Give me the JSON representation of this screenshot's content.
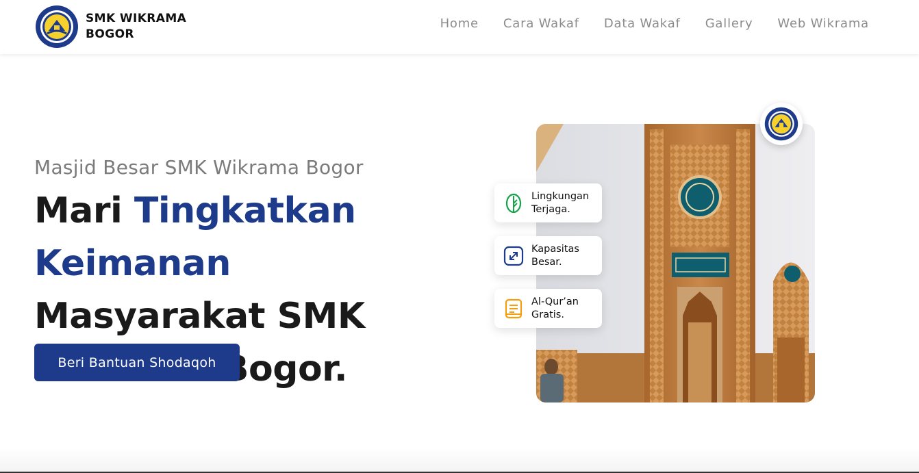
{
  "header": {
    "brand_line1": "SMK WIKRAMA",
    "brand_line2": "BOGOR",
    "logo_icon": "school-logo-icon",
    "nav": [
      {
        "label": "Home"
      },
      {
        "label": "Cara Wakaf"
      },
      {
        "label": "Data Wakaf"
      },
      {
        "label": "Gallery"
      },
      {
        "label": "Web Wikrama"
      }
    ]
  },
  "hero": {
    "subtitle": "Masjid Besar SMK Wikrama Bogor",
    "title_part1": "Mari ",
    "title_highlight": "Tingkatkan Keimanan",
    "title_part2": " Masyarakat SMK Wikrama Bogor.",
    "cta_label": "Beri Bantuan Shodaqoh"
  },
  "features": [
    {
      "label": "Lingkungan\nTerjaga.",
      "icon": "leaf-icon",
      "color": "#16a34a"
    },
    {
      "label": "Kapasitas\nBesar.",
      "icon": "expand-icon",
      "color": "#1e3a8a"
    },
    {
      "label": "Al-Qur’an\nGratis.",
      "icon": "book-icon",
      "color": "#f59e0b"
    }
  ],
  "colors": {
    "primary": "#1e3a8a",
    "nav_text": "#8c8c8c",
    "heading": "#1a1a1a"
  }
}
